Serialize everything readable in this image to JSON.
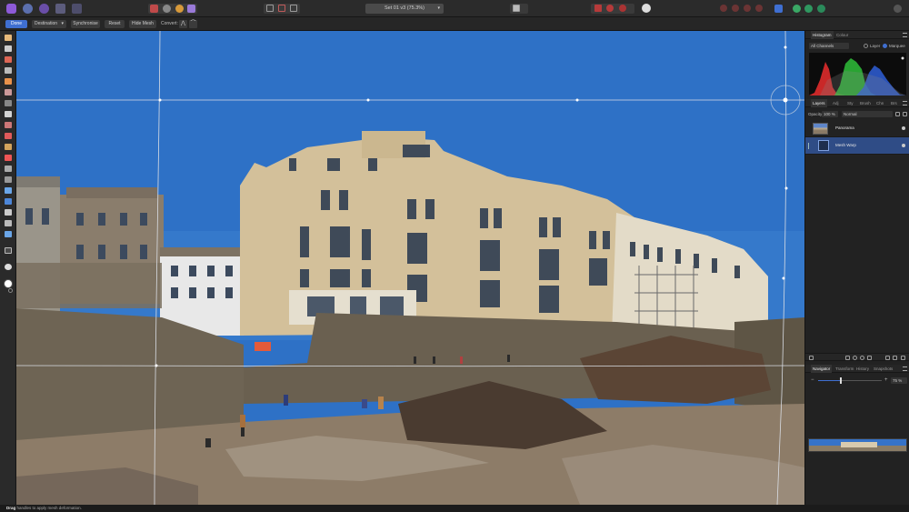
{
  "app": {
    "document_title": "Set 01 v3 (75.3%)",
    "status_key": "Drag",
    "status_text": "handles to apply mesh deformation."
  },
  "context_toolbar": {
    "done_label": "Done",
    "mode_value": "Destination",
    "synchronise_label": "Synchronise",
    "reset_label": "Reset",
    "hide_mesh_label": "Hide Mesh",
    "convert_label": "Convert:"
  },
  "histogram_panel": {
    "tabs": [
      {
        "label": "Histogram"
      },
      {
        "label": "Colour"
      }
    ],
    "channels_value": "All Channels",
    "option_layer": "Layer",
    "option_marquee": "Marquee"
  },
  "layers_panel": {
    "tabs": [
      {
        "label": "Layers"
      },
      {
        "label": "Adj"
      },
      {
        "label": "Sty"
      },
      {
        "label": "Brush"
      },
      {
        "label": "Chn"
      },
      {
        "label": "Brs"
      }
    ],
    "opacity_label": "Opacity:",
    "opacity_value": "100 %",
    "blend_mode": "Normal",
    "layers": [
      {
        "name": "Panorama",
        "selected": false
      },
      {
        "name": "Mesh Warp",
        "selected": true
      }
    ]
  },
  "navigator_panel": {
    "tabs": [
      {
        "label": "Navigator"
      },
      {
        "label": "Transform"
      },
      {
        "label": "History"
      },
      {
        "label": "Snapshots"
      }
    ],
    "zoom_value": "75 %",
    "zoom_fraction": 0.35
  },
  "colors": {
    "accent": "#3f6fd1",
    "sky": "#2d6fc4",
    "persona": "#8d5ad8"
  }
}
